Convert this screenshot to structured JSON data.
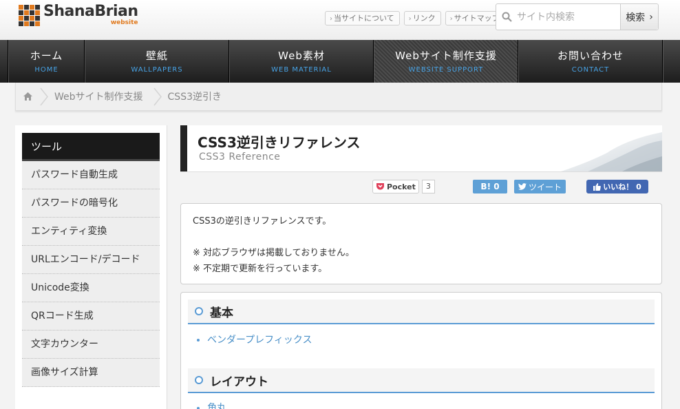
{
  "header": {
    "logo_name": "ShanaBrian",
    "logo_sub": "website",
    "links": [
      "当サイトについて",
      "リンク",
      "サイトマップ"
    ],
    "search_placeholder": "サイト内検索",
    "search_button": "検索"
  },
  "nav": [
    {
      "title": "ホーム",
      "sub": "HOME"
    },
    {
      "title": "壁紙",
      "sub": "WALLPAPERS"
    },
    {
      "title": "Web素材",
      "sub": "WEB MATERIAL"
    },
    {
      "title": "Webサイト制作支援",
      "sub": "WEBSITE SUPPORT"
    },
    {
      "title": "お問い合わせ",
      "sub": "CONTACT"
    }
  ],
  "breadcrumb": [
    "Webサイト制作支援",
    "CSS3逆引き"
  ],
  "sidebar": {
    "heading": "ツール",
    "items": [
      "パスワード自動生成",
      "パスワードの暗号化",
      "エンティティ変換",
      "URLエンコード/デコード",
      "Unicode変換",
      "QRコード生成",
      "文字カウンター",
      "画像サイズ計算"
    ]
  },
  "page": {
    "title": "CSS3逆引きリファレンス",
    "subtitle": "CSS3 Reference"
  },
  "share": {
    "pocket_label": "Pocket",
    "pocket_count": "3",
    "hatena_label": "B! 0",
    "tweet_label": "ツイート",
    "like_label": "いいね！ 0"
  },
  "intro": {
    "line1": "CSS3の逆引きリファレンスです。",
    "line2": "※ 対応ブラウザは掲載しておりません。",
    "line3": "※ 不定期で更新を行っています。"
  },
  "sections": [
    {
      "title": "基本",
      "items": [
        "ベンダープレフィックス"
      ]
    },
    {
      "title": "レイアウト",
      "items": [
        "角丸"
      ]
    }
  ],
  "colors": {
    "accent": "#5a9bd5",
    "nav_sub": "#47a3e6",
    "logo_sub": "#e07a1f"
  }
}
